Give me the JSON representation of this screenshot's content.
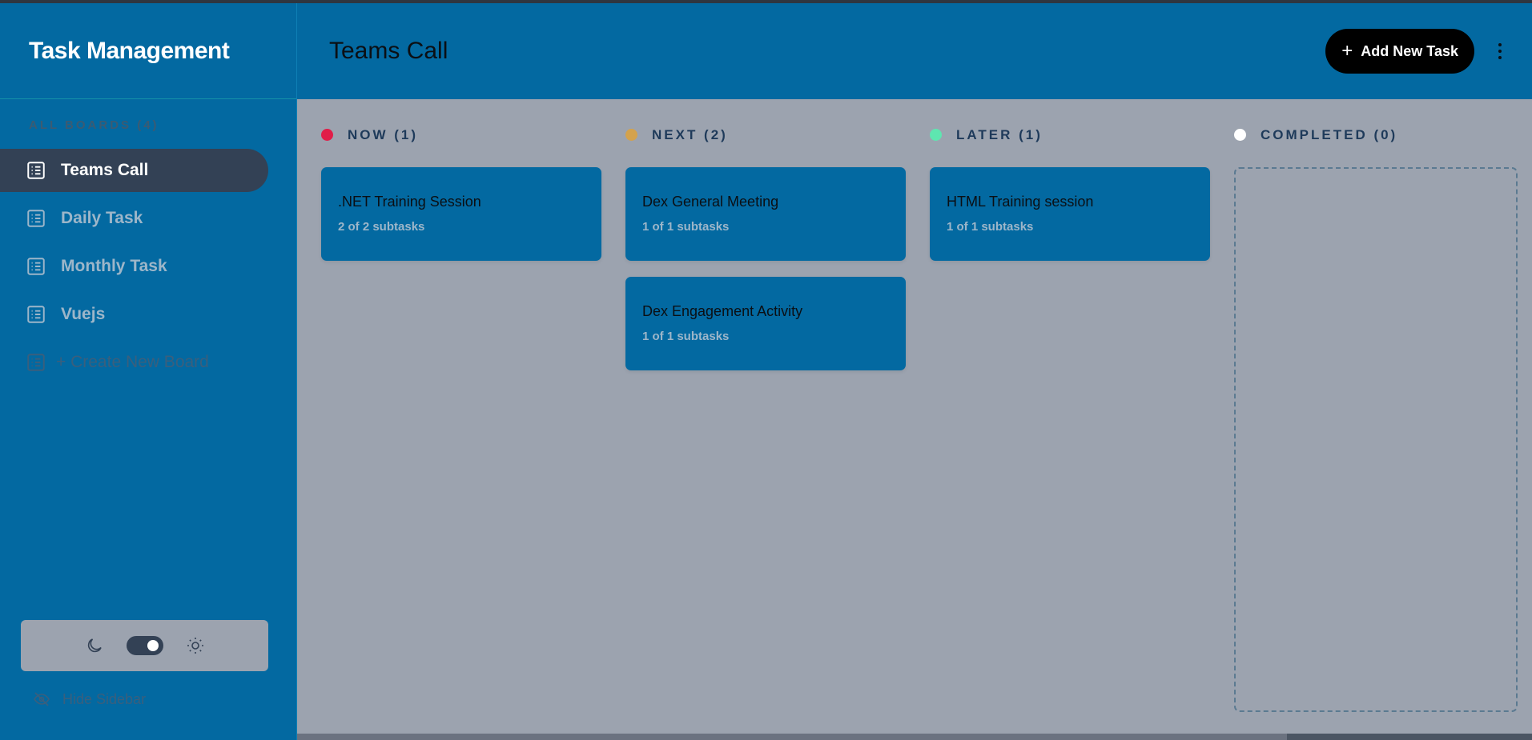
{
  "app": {
    "title": "Task Management"
  },
  "sidebar": {
    "boards_label": "ALL BOARDS (4)",
    "items": [
      {
        "label": "Teams Call",
        "active": true
      },
      {
        "label": "Daily Task",
        "active": false
      },
      {
        "label": "Monthly Task",
        "active": false
      },
      {
        "label": "Vuejs",
        "active": false
      }
    ],
    "create_label": "+ Create New Board",
    "hide_label": "Hide Sidebar",
    "theme": {
      "dark_icon": "moon-icon",
      "light_icon": "sun-icon",
      "mode": "dark"
    }
  },
  "header": {
    "title": "Teams Call",
    "add_label": "Add New Task",
    "menu_icon": "kebab-menu-icon"
  },
  "columns": [
    {
      "label": "NOW (1)",
      "color": "#e11d48",
      "cards": [
        {
          "title": ".NET Training Session",
          "subtasks": "2 of 2 subtasks"
        }
      ]
    },
    {
      "label": "NEXT (2)",
      "color": "#d4a24c",
      "cards": [
        {
          "title": "Dex General Meeting",
          "subtasks": "1 of 1 subtasks"
        },
        {
          "title": "Dex Engagement Activity",
          "subtasks": "1 of 1 subtasks"
        }
      ]
    },
    {
      "label": "LATER (1)",
      "color": "#5ee6b0",
      "cards": [
        {
          "title": "HTML Training session",
          "subtasks": "1 of 1 subtasks"
        }
      ]
    },
    {
      "label": "COMPLETED (0)",
      "color": "#ffffff",
      "cards": []
    }
  ],
  "colors": {
    "primary": "#0369a1",
    "active_item": "#334155",
    "board_bg": "#9ca3af",
    "button": "#000000"
  }
}
